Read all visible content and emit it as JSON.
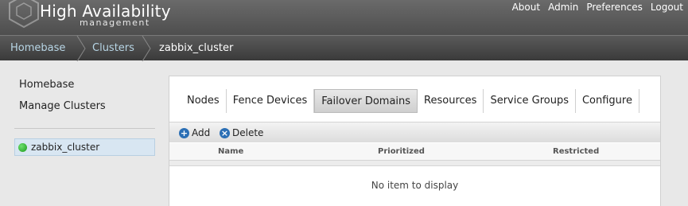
{
  "header": {
    "title": "High Availability",
    "subtitle": "management",
    "links": [
      "About",
      "Admin",
      "Preferences",
      "Logout"
    ]
  },
  "breadcrumb": {
    "items": [
      "Homebase",
      "Clusters",
      "zabbix_cluster"
    ]
  },
  "sidebar": {
    "links": [
      "Homebase",
      "Manage Clusters"
    ],
    "clusters": [
      {
        "label": "zabbix_cluster",
        "status_color": "#22aa22"
      }
    ]
  },
  "tabs": [
    "Nodes",
    "Fence Devices",
    "Failover Domains",
    "Resources",
    "Service Groups",
    "Configure"
  ],
  "active_tab": "Failover Domains",
  "toolbar": {
    "add_label": "Add",
    "delete_label": "Delete",
    "add_icon": "add-circle-icon",
    "delete_icon": "delete-circle-icon"
  },
  "grid": {
    "columns": [
      "Name",
      "Prioritized",
      "Restricted"
    ],
    "empty_text": "No item to display"
  },
  "colors": {
    "accent": "#2b6fb5",
    "breadcrumb_link": "#b8d6e6",
    "selected_row": "#d8e6f2"
  }
}
